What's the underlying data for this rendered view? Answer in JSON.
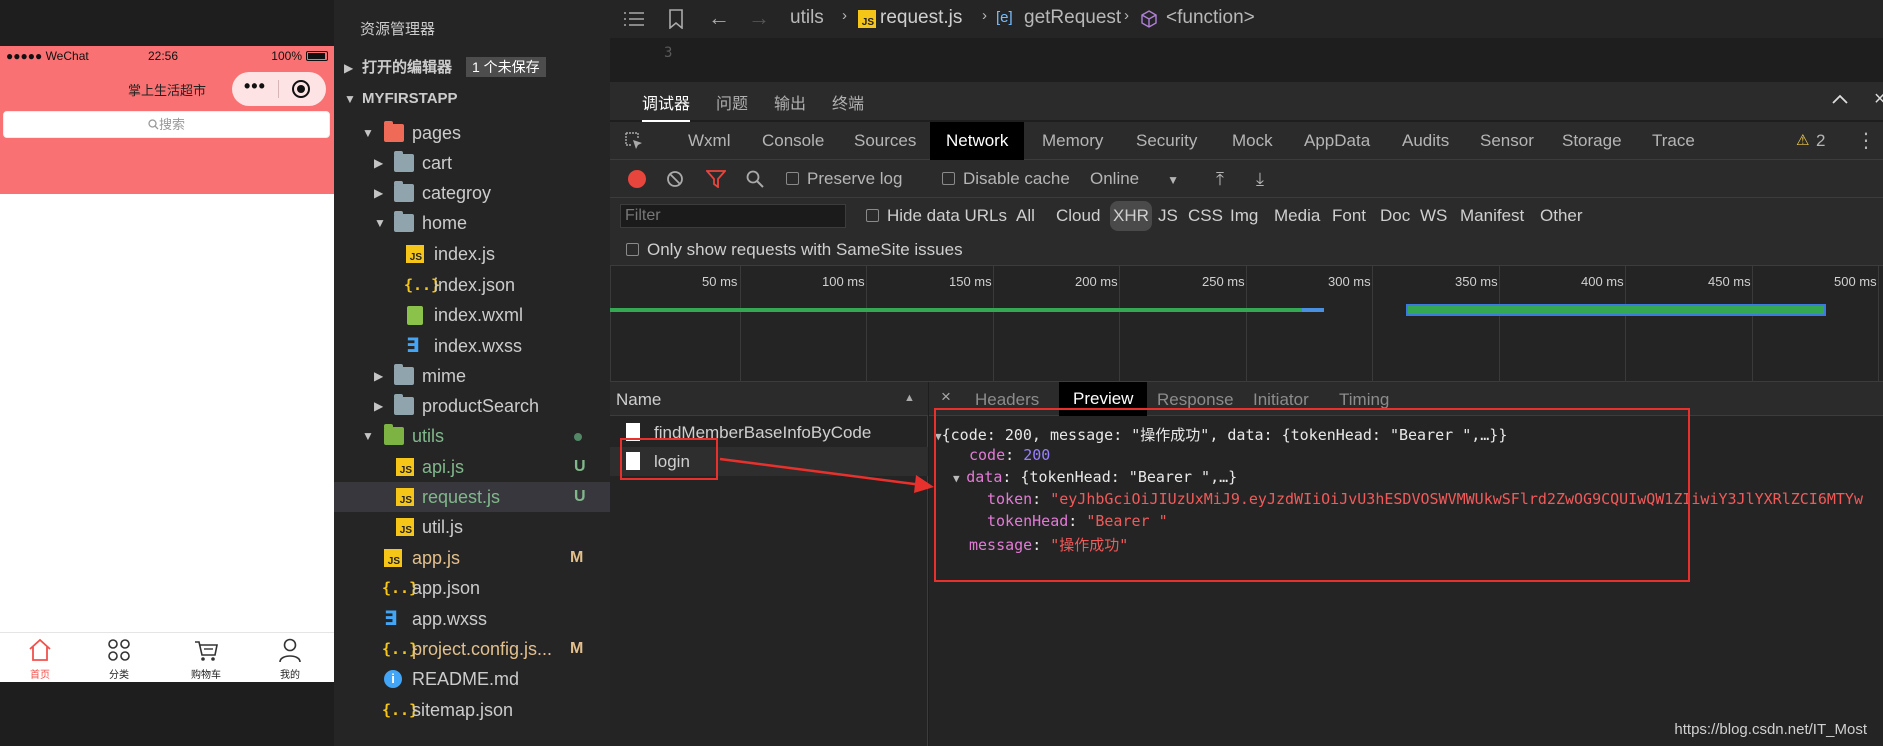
{
  "phone": {
    "signal": "●●●●● WeChat",
    "time": "22:56",
    "battery": "100%",
    "nav_title": "掌上生活超市",
    "search_placeholder": "搜索",
    "tabs": [
      {
        "label": "首页",
        "icon": "home-icon",
        "active": true
      },
      {
        "label": "分类",
        "icon": "grid-icon",
        "active": false
      },
      {
        "label": "购物车",
        "icon": "cart-icon",
        "active": false
      },
      {
        "label": "我的",
        "icon": "user-icon",
        "active": false
      }
    ]
  },
  "explorer": {
    "title": "资源管理器",
    "open_editors": "打开的编辑器",
    "unsaved": "1 个未保存",
    "project": "MYFIRSTAPP",
    "tree": [
      {
        "label": "pages",
        "type": "folder-open",
        "depth": 1,
        "status": ""
      },
      {
        "label": "cart",
        "type": "folder",
        "depth": 2,
        "status": ""
      },
      {
        "label": "categroy",
        "type": "folder",
        "depth": 2,
        "status": ""
      },
      {
        "label": "home",
        "type": "folder-open",
        "depth": 2,
        "status": ""
      },
      {
        "label": "index.js",
        "type": "js",
        "depth": 3,
        "status": ""
      },
      {
        "label": "index.json",
        "type": "json",
        "depth": 3,
        "status": ""
      },
      {
        "label": "index.wxml",
        "type": "wxml",
        "depth": 3,
        "status": ""
      },
      {
        "label": "index.wxss",
        "type": "wxss",
        "depth": 3,
        "status": ""
      },
      {
        "label": "mime",
        "type": "folder",
        "depth": 2,
        "status": ""
      },
      {
        "label": "productSearch",
        "type": "folder",
        "depth": 2,
        "status": ""
      },
      {
        "label": "utils",
        "type": "folder-open",
        "depth": 1,
        "status": "dot"
      },
      {
        "label": "api.js",
        "type": "js",
        "depth": 2,
        "status": "U"
      },
      {
        "label": "request.js",
        "type": "js",
        "depth": 2,
        "status": "U"
      },
      {
        "label": "util.js",
        "type": "js",
        "depth": 2,
        "status": ""
      },
      {
        "label": "app.js",
        "type": "js",
        "depth": 1,
        "status": "M"
      },
      {
        "label": "app.json",
        "type": "json",
        "depth": 1,
        "status": ""
      },
      {
        "label": "app.wxss",
        "type": "wxss",
        "depth": 1,
        "status": ""
      },
      {
        "label": "project.config.js...",
        "type": "json",
        "depth": 1,
        "status": "M"
      },
      {
        "label": "README.md",
        "type": "info",
        "depth": 1,
        "status": ""
      },
      {
        "label": "sitemap.json",
        "type": "json",
        "depth": 1,
        "status": ""
      }
    ],
    "status_u": "U",
    "status_m": "M"
  },
  "breadcrumb": {
    "folder": "utils",
    "file": "request.js",
    "symbol": "getRequest",
    "function": "<function>",
    "line_number": "3"
  },
  "devtools": {
    "panel_tabs": [
      "调试器",
      "问题",
      "输出",
      "终端"
    ],
    "tabs": [
      "Wxml",
      "Console",
      "Sources",
      "Network",
      "Memory",
      "Security",
      "Mock",
      "AppData",
      "Audits",
      "Sensor",
      "Storage",
      "Trace"
    ],
    "active_tab": "Network",
    "warning_count": "2",
    "preserve_log": "Preserve log",
    "disable_cache": "Disable cache",
    "throttle": "Online",
    "filter_placeholder": "Filter",
    "hide_data_urls": "Hide data URLs",
    "filter_types": [
      "All",
      "Cloud",
      "XHR",
      "JS",
      "CSS",
      "Img",
      "Media",
      "Font",
      "Doc",
      "WS",
      "Manifest",
      "Other"
    ],
    "active_filter": "XHR",
    "samesite": "Only show requests with SameSite issues",
    "timeline_labels": [
      "50 ms",
      "100 ms",
      "150 ms",
      "200 ms",
      "250 ms",
      "300 ms",
      "350 ms",
      "400 ms",
      "450 ms",
      "500 ms"
    ],
    "name_header": "Name",
    "requests": [
      "findMemberBaseInfoByCode",
      "login"
    ],
    "detail_tabs": [
      "Headers",
      "Preview",
      "Response",
      "Initiator",
      "Timing"
    ],
    "active_detail_tab": "Preview"
  },
  "preview": {
    "summary": "{code: 200, message: \"操作成功\", data: {tokenHead: \"Bearer \",…}}",
    "code_key": "code",
    "code_value": "200",
    "data_key": "data",
    "data_summary": "{tokenHead: \"Bearer \",…}",
    "token_key": "token",
    "token_value": "\"eyJhbGciOiJIUzUxMiJ9.eyJzdWIiOiJvU3hESDVOSWVMWUkwSFlrd2ZwOG9CQUIwQW1ZIiwiY3JlYXRlZCI6MTYw",
    "tokenhead_key": "tokenHead",
    "tokenhead_value": "\"Bearer \"",
    "message_key": "message",
    "message_value": "\"操作成功\""
  },
  "watermark": "https://blog.csdn.net/IT_Most",
  "colors": {
    "accent_red": "#e8312d",
    "phone_header": "#f97172",
    "git_untracked": "#81b88b",
    "git_modified": "#e2c08d"
  }
}
